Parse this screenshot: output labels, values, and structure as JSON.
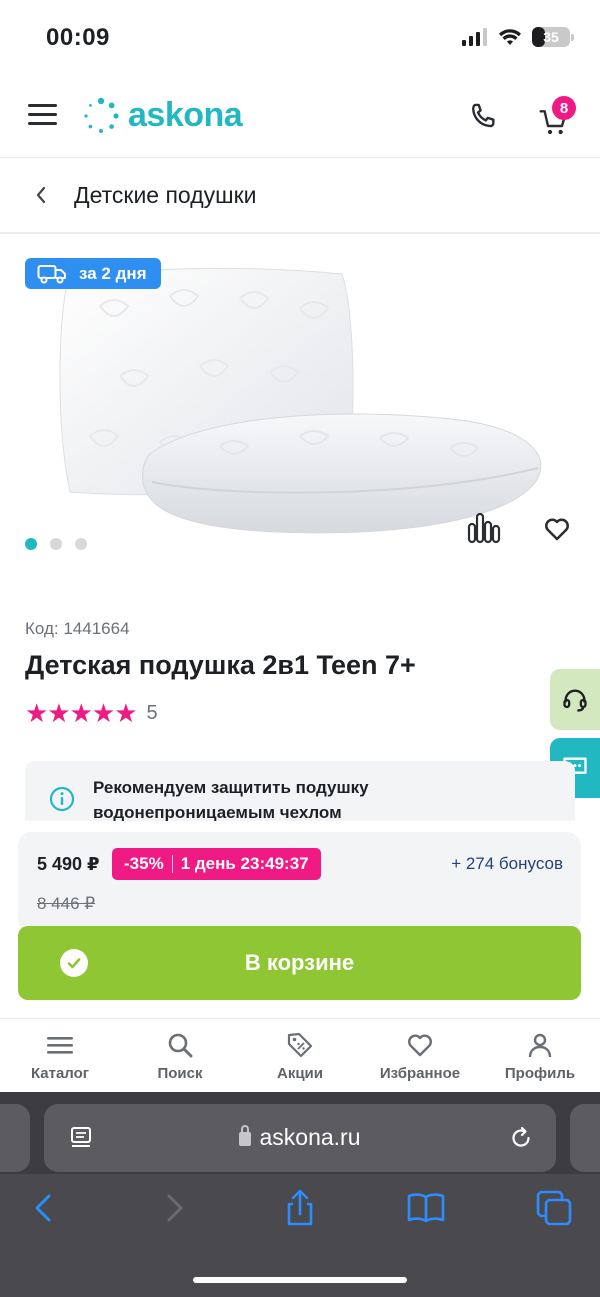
{
  "status": {
    "time": "00:09",
    "battery": "35"
  },
  "header": {
    "logo": "askona",
    "cart_count": "8"
  },
  "breadcrumb": {
    "title": "Детские подушки"
  },
  "product": {
    "delivery_badge": "за 2 дня",
    "code": "Код: 1441664",
    "title": "Детская подушка 2в1 Teen 7+",
    "rating_stars": "★★★★★",
    "rating_count": "5",
    "slides_total": 3,
    "slide_active": 1
  },
  "recommend": {
    "text": "Рекомендуем защитить подушку водонепроницаемым чехлом"
  },
  "price": {
    "current": "5 490 ₽",
    "discount": "-35%",
    "timer": "1 день 23:49:37",
    "bonus": "+ 274 бонусов",
    "old": "8 446 ₽"
  },
  "cta": {
    "label": "В корзине"
  },
  "bottom_nav": [
    {
      "label": "Каталог",
      "icon": "menu-icon"
    },
    {
      "label": "Поиск",
      "icon": "search-icon"
    },
    {
      "label": "Акции",
      "icon": "discount-tag-icon"
    },
    {
      "label": "Избранное",
      "icon": "heart-icon"
    },
    {
      "label": "Профиль",
      "icon": "profile-icon"
    }
  ],
  "browser": {
    "url": "askona.ru"
  },
  "colors": {
    "brand": "#21b8c2",
    "accent": "#ef1a83",
    "cta": "#8fc633",
    "delivery": "#2f8ff1"
  }
}
